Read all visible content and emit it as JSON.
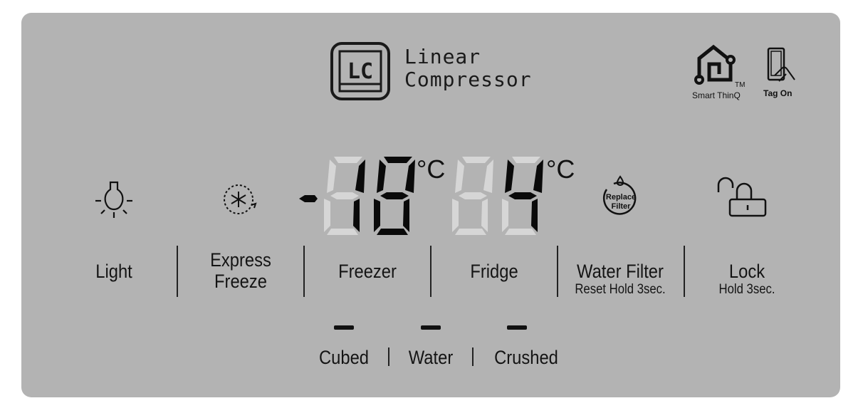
{
  "brand": {
    "logo_letters": "LC",
    "line1": "Linear",
    "line2": "Compressor"
  },
  "badges": {
    "smart_thinq": "Smart ThinQ",
    "tm": "TM",
    "tag_on": "Tag On"
  },
  "display": {
    "freezer": {
      "sign": "-",
      "digits": [
        "1",
        "8"
      ],
      "unit": "°C",
      "value": -18
    },
    "fridge": {
      "digits": [
        "",
        "4"
      ],
      "unit": "°C",
      "value": 4
    },
    "colors": {
      "on": "#0a0a0a",
      "off": "#d6d6d6"
    }
  },
  "buttons": [
    {
      "label": "Light",
      "icon": "light-bulb-icon"
    },
    {
      "label": "Express Freeze",
      "line1": "Express",
      "line2": "Freeze",
      "icon": "express-freeze-icon"
    },
    {
      "label": "Freezer"
    },
    {
      "label": "Fridge"
    },
    {
      "label": "Water Filter",
      "sub": "Reset Hold 3sec.",
      "icon": "replace-filter-icon",
      "icon_text1": "Replace",
      "icon_text2": "Filter"
    },
    {
      "label": "Lock",
      "sub": "Hold 3sec.",
      "icon": "unlock-icon"
    }
  ],
  "dispenser": [
    {
      "label": "Cubed",
      "selected": false
    },
    {
      "label": "Water",
      "selected": false
    },
    {
      "label": "Crushed",
      "selected": false
    }
  ],
  "colors": {
    "panel": "#b3b3b3",
    "text": "#141414"
  }
}
